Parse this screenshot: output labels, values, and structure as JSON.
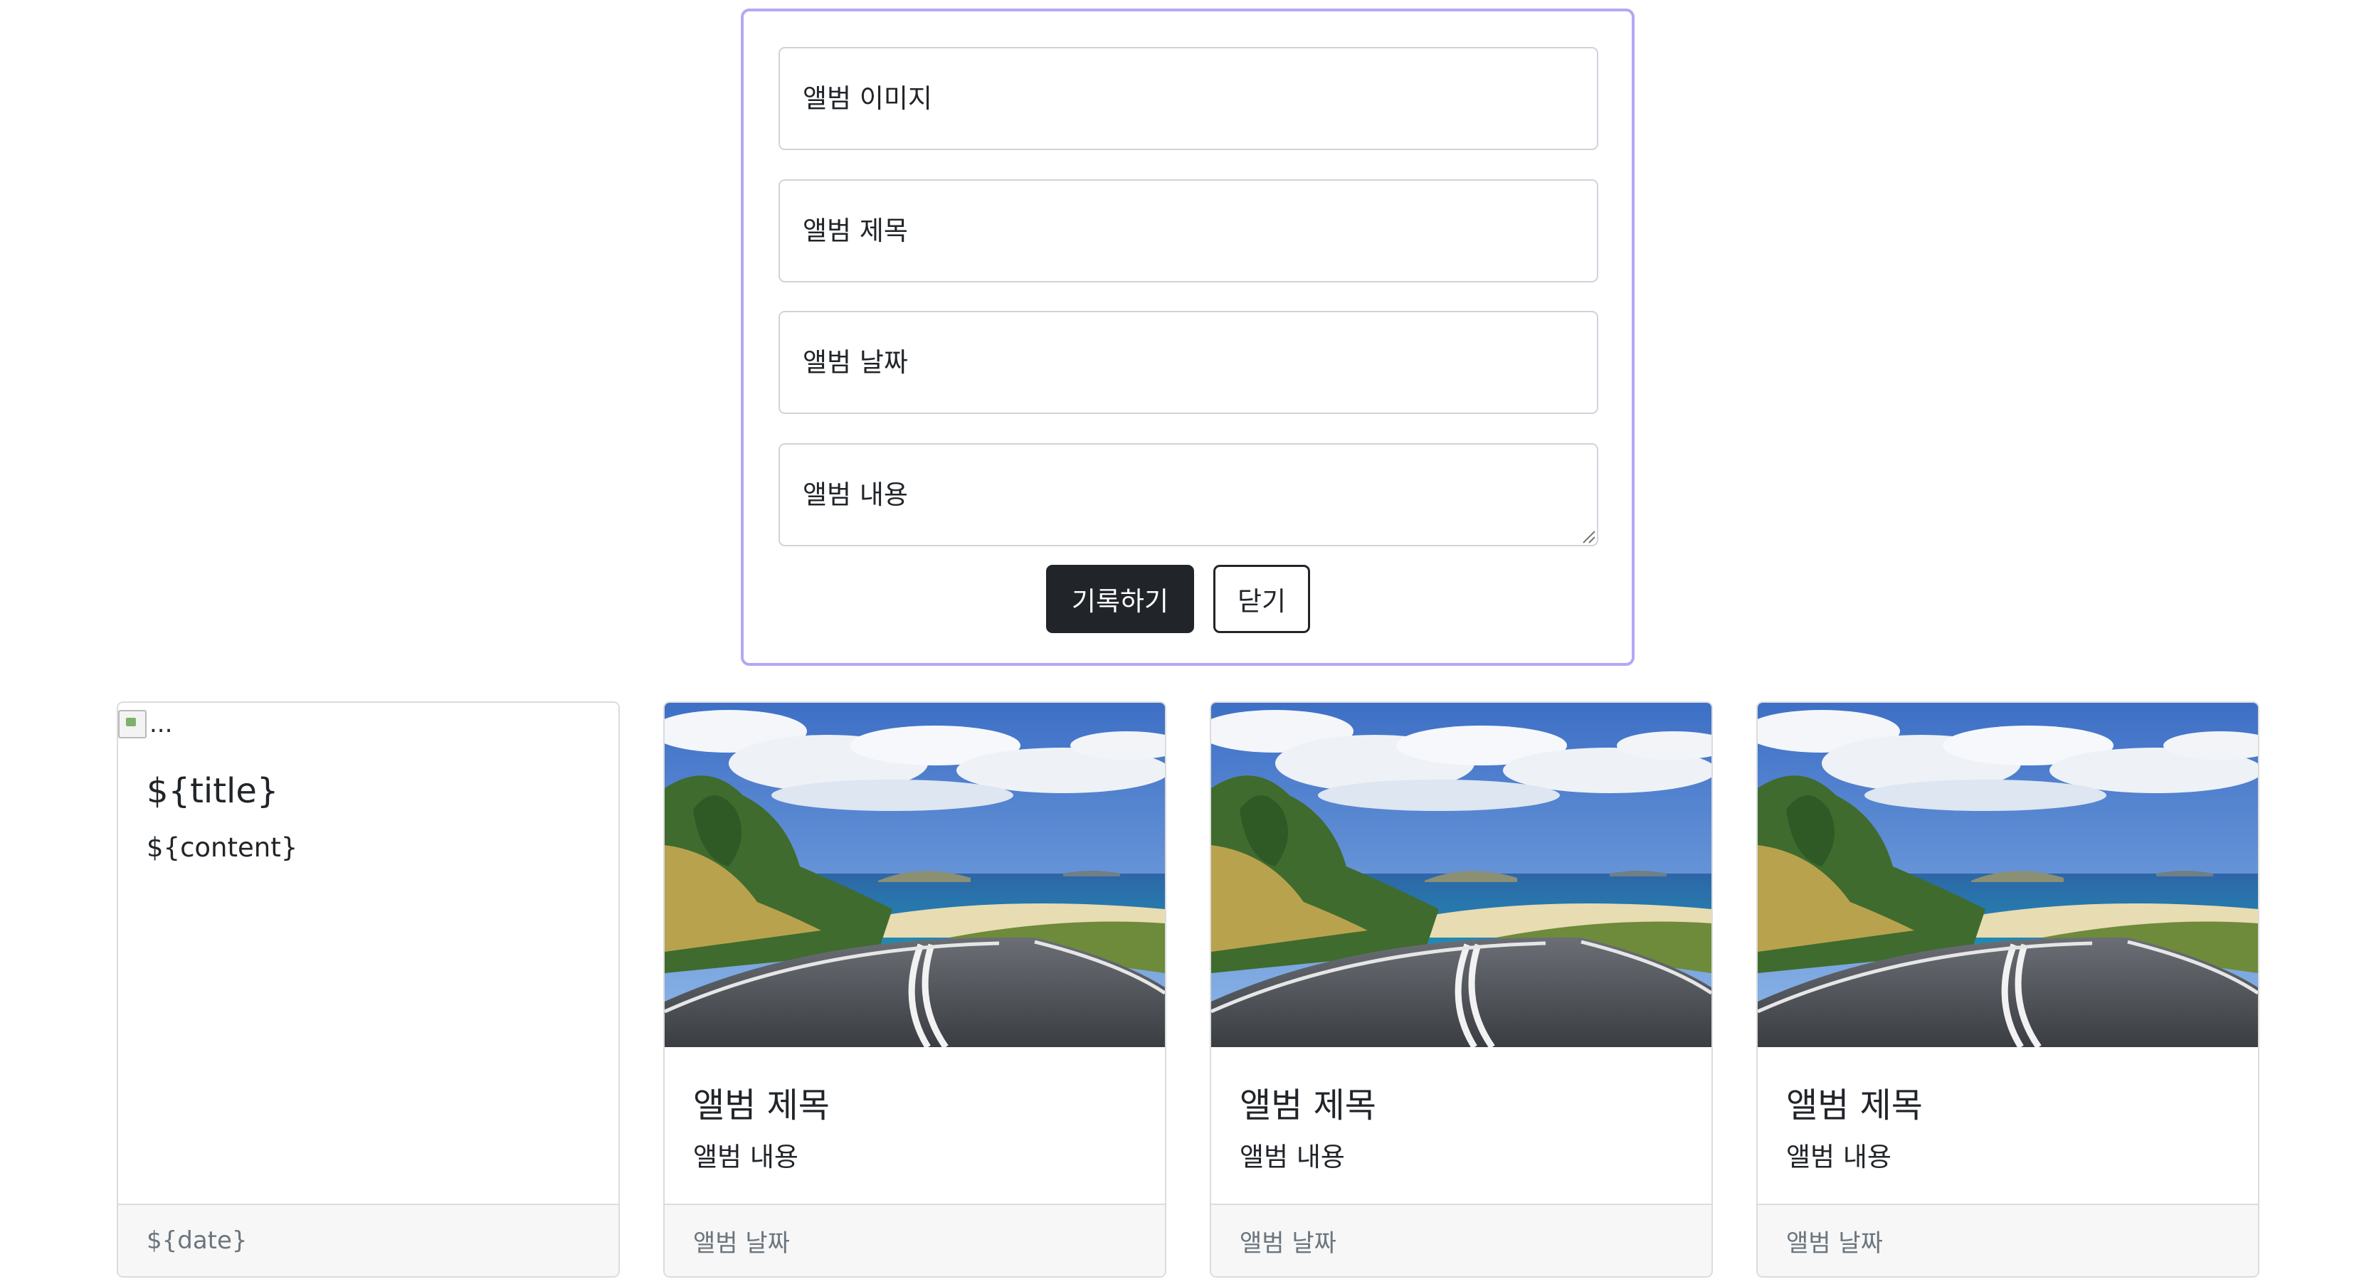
{
  "form": {
    "image_placeholder": "앨범 이미지",
    "title_placeholder": "앨범 제목",
    "date_placeholder": "앨범 날짜",
    "content_placeholder": "앨범 내용",
    "record_label": "기록하기",
    "close_label": "닫기"
  },
  "cards": [
    {
      "image_alt": "...",
      "title": "${title}",
      "content": "${content}",
      "date": "${date}",
      "image_broken": true
    },
    {
      "title": "앨범 제목",
      "content": "앨범 내용",
      "date": "앨범 날짜"
    },
    {
      "title": "앨범 제목",
      "content": "앨범 내용",
      "date": "앨범 날짜"
    },
    {
      "title": "앨범 제목",
      "content": "앨범 내용",
      "date": "앨범 날짜"
    }
  ],
  "colors": {
    "panel_border": "#b7a6f5",
    "primary_button": "#212529",
    "footer_bg": "#f7f7f7",
    "footer_text": "#6c757d"
  }
}
